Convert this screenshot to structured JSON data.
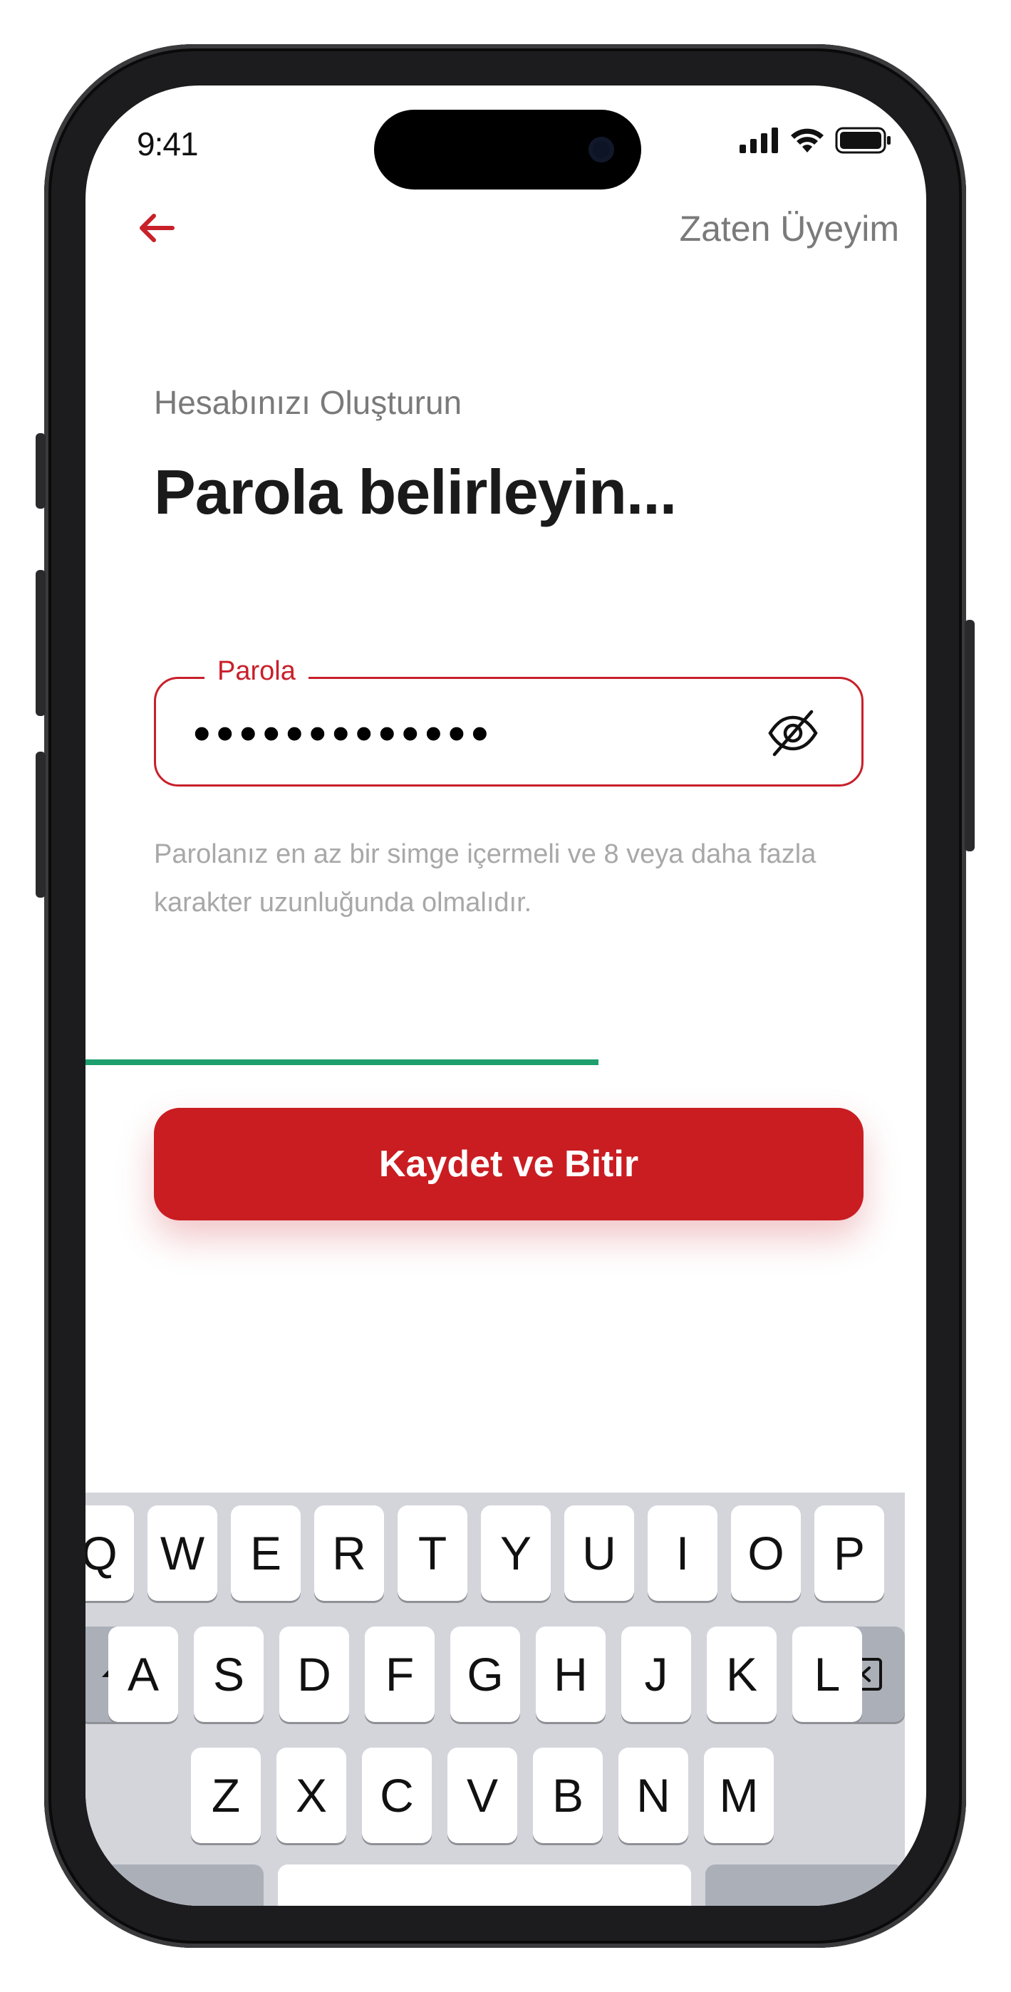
{
  "status_bar": {
    "time": "9:41"
  },
  "header": {
    "login_link": "Zaten Üyeyim"
  },
  "content": {
    "subtitle": "Hesabınızı Oluşturun",
    "title": "Parola belirleyin...",
    "password_label": "Parola",
    "password_value": "•••••••••••••",
    "hint": "Parolanız en az bir simge içermeli ve 8 veya daha fazla karakter uzunluğunda olmalıdır.",
    "strength_fraction": 0.61,
    "save_button": "Kaydet ve Bitir"
  },
  "colors": {
    "accent": "#c91d22",
    "strength": "#1e9f6e",
    "muted_text": "#7a7a7a",
    "hint_text": "#a8a8a8"
  },
  "keyboard": {
    "row1": [
      "Q",
      "W",
      "E",
      "R",
      "T",
      "Y",
      "U",
      "I",
      "O",
      "P"
    ],
    "row2": [
      "A",
      "S",
      "D",
      "F",
      "G",
      "H",
      "J",
      "K",
      "L"
    ],
    "row3": [
      "Z",
      "X",
      "C",
      "V",
      "B",
      "N",
      "M"
    ],
    "shift_icon": "shift-icon",
    "backspace_icon": "backspace-icon"
  }
}
